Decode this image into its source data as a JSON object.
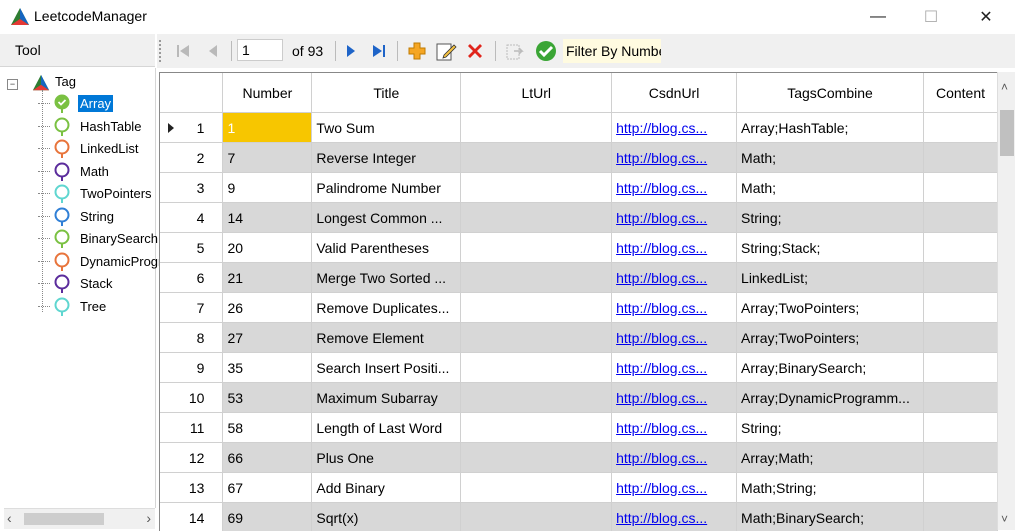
{
  "window": {
    "title": "LeetcodeManager",
    "controls": {
      "minimize": "—",
      "maximize": "☐",
      "close": "✕"
    }
  },
  "sidebar": {
    "tool_label": "Tool",
    "root_label": "Tag",
    "items": [
      {
        "label": "Array",
        "color": "#7ac142",
        "selected": true
      },
      {
        "label": "HashTable",
        "color": "#7ac142"
      },
      {
        "label": "LinkedList",
        "color": "#e8743b"
      },
      {
        "label": "Math",
        "color": "#5b2c9c"
      },
      {
        "label": "TwoPointers",
        "color": "#5fd6d0"
      },
      {
        "label": "String",
        "color": "#2f7fd6"
      },
      {
        "label": "BinarySearch",
        "color": "#7ac142"
      },
      {
        "label": "DynamicProgramming",
        "color": "#e8743b"
      },
      {
        "label": "Stack",
        "color": "#5b2c9c"
      },
      {
        "label": "Tree",
        "color": "#5fd6d0"
      }
    ]
  },
  "toolbar": {
    "current_page": "1",
    "page_of": "of 93",
    "filter_label": "Filter By Number"
  },
  "grid": {
    "columns": [
      "Number",
      "Title",
      "LtUrl",
      "CsdnUrl",
      "TagsCombine",
      "Content"
    ],
    "rows": [
      {
        "idx": "1",
        "number": "1",
        "title": "Two Sum",
        "csdn": "http://blog.cs...",
        "tags": "Array;HashTable;"
      },
      {
        "idx": "2",
        "number": "7",
        "title": "Reverse Integer",
        "csdn": "http://blog.cs...",
        "tags": "Math;"
      },
      {
        "idx": "3",
        "number": "9",
        "title": "Palindrome Number",
        "csdn": "http://blog.cs...",
        "tags": "Math;"
      },
      {
        "idx": "4",
        "number": "14",
        "title": "Longest Common ...",
        "csdn": "http://blog.cs...",
        "tags": "String;"
      },
      {
        "idx": "5",
        "number": "20",
        "title": "Valid Parentheses",
        "csdn": "http://blog.cs...",
        "tags": "String;Stack;"
      },
      {
        "idx": "6",
        "number": "21",
        "title": "Merge Two Sorted ...",
        "csdn": "http://blog.cs...",
        "tags": "LinkedList;"
      },
      {
        "idx": "7",
        "number": "26",
        "title": "Remove Duplicates...",
        "csdn": "http://blog.cs...",
        "tags": "Array;TwoPointers;"
      },
      {
        "idx": "8",
        "number": "27",
        "title": "Remove Element",
        "csdn": "http://blog.cs...",
        "tags": "Array;TwoPointers;"
      },
      {
        "idx": "9",
        "number": "35",
        "title": "Search Insert Positi...",
        "csdn": "http://blog.cs...",
        "tags": "Array;BinarySearch;"
      },
      {
        "idx": "10",
        "number": "53",
        "title": "Maximum Subarray",
        "csdn": "http://blog.cs...",
        "tags": "Array;DynamicProgramm..."
      },
      {
        "idx": "11",
        "number": "58",
        "title": "Length of Last Word",
        "csdn": "http://blog.cs...",
        "tags": "String;"
      },
      {
        "idx": "12",
        "number": "66",
        "title": "Plus One",
        "csdn": "http://blog.cs...",
        "tags": "Array;Math;"
      },
      {
        "idx": "13",
        "number": "67",
        "title": "Add Binary",
        "csdn": "http://blog.cs...",
        "tags": "Math;String;"
      },
      {
        "idx": "14",
        "number": "69",
        "title": "Sqrt(x)",
        "csdn": "http://blog.cs...",
        "tags": "Math;BinarySearch;"
      }
    ]
  },
  "colors": {
    "selection": "#0078d7",
    "cell_highlight": "#f7c600",
    "alt_row": "#d8d8d8",
    "link": "#0000ee"
  }
}
